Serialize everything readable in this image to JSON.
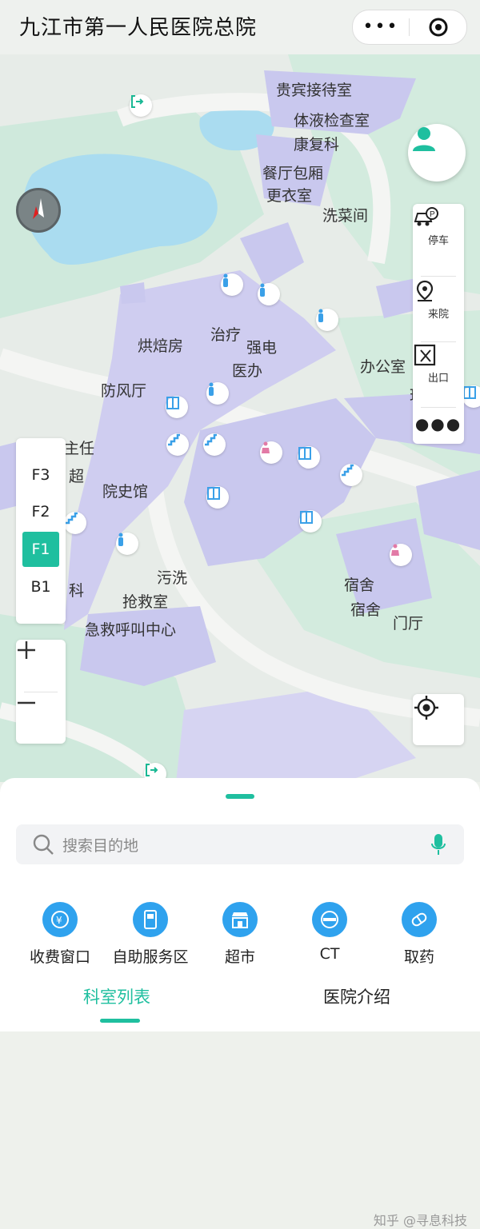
{
  "header": {
    "title": "九江市第一人民医院总院",
    "more_icon": "more-dots-icon",
    "close_icon": "target-circle-icon"
  },
  "map": {
    "labels": [
      "贵宾接待室",
      "体液检查室",
      "康复科",
      "餐厅包厢",
      "更衣室",
      "洗菜间",
      "烘焙房",
      "治疗",
      "强电",
      "医办",
      "办公室",
      "防风厅",
      "主任",
      "超",
      "院史馆",
      "污洗",
      "科",
      "抢救室",
      "急救呼叫中心",
      "宿舍",
      "宿舍",
      "门厅",
      "玛"
    ]
  },
  "tools": {
    "parking": "停车",
    "arrive": "来院",
    "exit": "出口",
    "more_icon": "more-dots-icon"
  },
  "floors": {
    "items": [
      "F3",
      "F2",
      "F1",
      "B1"
    ],
    "active": "F1"
  },
  "zoom": {
    "in_icon": "plus-icon",
    "out_icon": "minus-icon"
  },
  "search": {
    "placeholder": "搜索目的地"
  },
  "categories": [
    {
      "label": "收费窗口",
      "icon": "yen-icon"
    },
    {
      "label": "自助服务区",
      "icon": "kiosk-icon"
    },
    {
      "label": "超市",
      "icon": "store-icon"
    },
    {
      "label": "CT",
      "icon": "ct-scanner-icon"
    },
    {
      "label": "取药",
      "icon": "pill-icon"
    }
  ],
  "tabs": [
    {
      "label": "科室列表",
      "active": true
    },
    {
      "label": "医院介绍",
      "active": false
    }
  ],
  "watermark": "知乎 @寻息科技",
  "colors": {
    "accent": "#1fbf9f",
    "category_blue": "#2fa2ee",
    "map_green": "#cfe9dc",
    "map_building": "#c9c8ee",
    "map_water": "#aadcf0"
  }
}
